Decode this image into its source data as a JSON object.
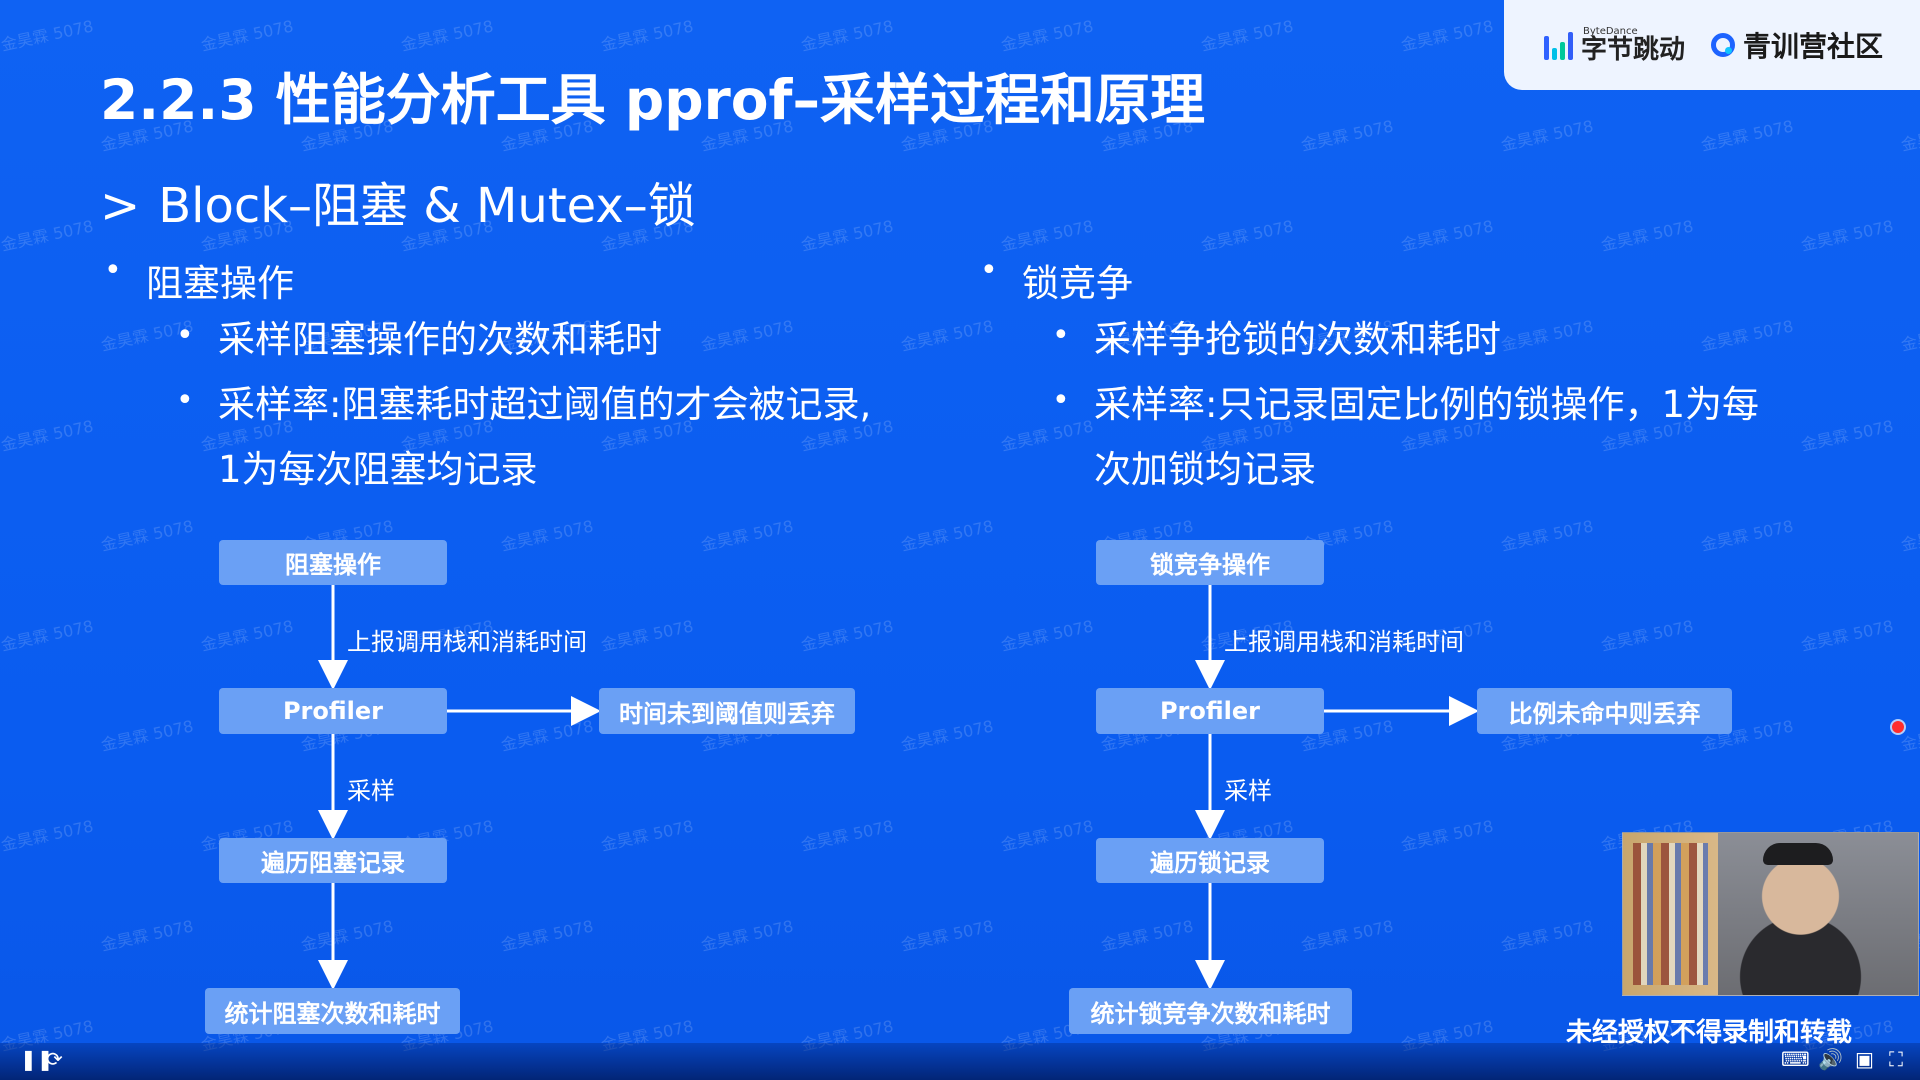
{
  "header": {
    "title": "2.2.3 性能分析工具 pprof–采样过程和原理"
  },
  "section": {
    "subtitle_prefix": ">",
    "subtitle_text": "Block–阻塞 & Mutex–锁"
  },
  "logos": {
    "bytedance_small": "ByteDance",
    "bytedance_text": "字节跳动",
    "community_text": "青训营社区"
  },
  "left": {
    "heading": "阻塞操作",
    "items": [
      "采样阻塞操作的次数和耗时",
      "采样率:阻塞耗时超过阈值的才会被记录,",
      "1为每次阻塞均记录"
    ],
    "flow": {
      "start": "阻塞操作",
      "edge1": "上报调用栈和消耗时间",
      "profiler": "Profiler",
      "discard": "时间未到阈值则丢弃",
      "edge2": "采样",
      "traverse": "遍历阻塞记录",
      "end": "统计阻塞次数和耗时"
    }
  },
  "right": {
    "heading": "锁竞争",
    "items": [
      "采样争抢锁的次数和耗时",
      "采样率:只记录固定比例的锁操作，1为每",
      "次加锁均记录"
    ],
    "flow": {
      "start": "锁竞争操作",
      "edge1": "上报调用栈和消耗时间",
      "profiler": "Profiler",
      "discard": "比例未命中则丢弃",
      "edge2": "采样",
      "traverse": "遍历锁记录",
      "end": "统计锁竞争次数和耗时"
    }
  },
  "overlay": {
    "watermark_text": "金昊霖 5078",
    "warning": "未经授权不得录制和转载"
  },
  "controls": {
    "pause_icon": "pause-icon",
    "refresh_icon": "refresh-icon",
    "subtitle_icon": "subtitle-icon",
    "volume_icon": "volume-icon",
    "window_icon": "window-icon",
    "fullscreen_icon": "fullscreen-icon"
  },
  "colors": {
    "background": "#0d63f2",
    "box": "#6aa0f5",
    "white": "#ffffff",
    "accent": "#1d63ff"
  }
}
